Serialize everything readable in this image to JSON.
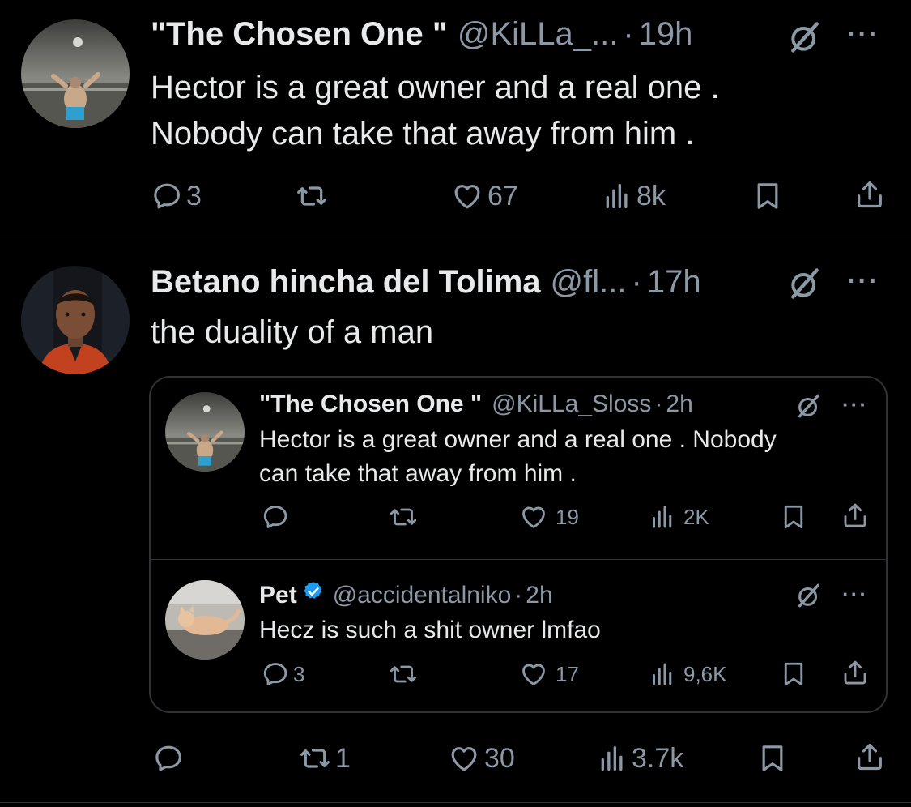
{
  "tweet1": {
    "name": "\"The Chosen One \"",
    "handle": "@KiLLa_...",
    "dot": "·",
    "time": "19h",
    "more": "···",
    "text_line1": "Hector is a great owner and a real one .",
    "text_line2": "Nobody can take that away from him .",
    "replies": "3",
    "retweets": "",
    "likes": "67",
    "views": "8k"
  },
  "tweet2": {
    "name": "Betano hincha del Tolima",
    "handle": "@fl...",
    "dot": "·",
    "time": "17h",
    "more": "···",
    "text": "the duality of a man",
    "replies": "",
    "retweets": "1",
    "likes": "30",
    "views": "3.7k"
  },
  "quote1": {
    "name": "\"The Chosen One \"",
    "handle": "@KiLLa_Sloss",
    "dot": "·",
    "time": "2h",
    "more": "···",
    "text_line1": "Hector is a great owner and a real one . Nobody",
    "text_line2": "can take that away from him .",
    "replies": "",
    "retweets": "",
    "likes": "19",
    "views": "2K"
  },
  "quote2": {
    "name": "Pet",
    "handle": "@accidentalniko",
    "dot": "·",
    "time": "2h",
    "more": "···",
    "text": "Hecz is such a shit owner lmfao",
    "replies": "3",
    "retweets": "",
    "likes": "17",
    "views": "9,6K"
  },
  "colors": {
    "background": "#000000",
    "text": "#e7e9ea",
    "secondary": "#8b98a5",
    "divider": "#2f3336",
    "verified": "#1d9bf0"
  },
  "icons": [
    "reply-icon",
    "retweet-icon",
    "like-icon",
    "views-icon",
    "bookmark-icon",
    "share-icon",
    "grok-icon",
    "more-icon",
    "verified-icon"
  ]
}
